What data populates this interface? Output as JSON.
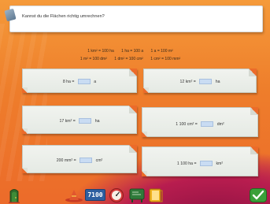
{
  "title": "Kannst du die Flächen richtig umrechnen?",
  "formulas": {
    "row1": [
      "1 km² = 100 ha",
      "1 ha = 100 a",
      "1 a = 100 m²"
    ],
    "row2": [
      "1 m² = 100 dm²",
      "1 dm² = 100 cm²",
      "1 cm² = 100 mm²"
    ]
  },
  "exercises": [
    {
      "left": "8 ha =",
      "right": "a",
      "value": ""
    },
    {
      "left": "12 km² =",
      "right": "ha",
      "value": ""
    },
    {
      "left": "17 km² =",
      "right": "ha",
      "value": ""
    },
    {
      "left": "1 100 cm² =",
      "right": "dm²",
      "value": ""
    },
    {
      "left": "200 mm² =",
      "right": "cm²",
      "value": ""
    },
    {
      "left": "1 100 ha =",
      "right": "km²",
      "value": ""
    }
  ],
  "toolbar": {
    "counter": "7100"
  },
  "colors": {
    "background": "#ec6b2a",
    "input_fill": "#c9dcf3",
    "card": "#e5eae4",
    "accent_blue": "#2f5fa0",
    "check_green": "#3aa03a"
  },
  "icons": [
    "exit-door-icon",
    "wizard-hat-icon",
    "counter-display",
    "speedometer-icon",
    "chalkboard-icon",
    "book-icon",
    "checkmark-icon"
  ]
}
